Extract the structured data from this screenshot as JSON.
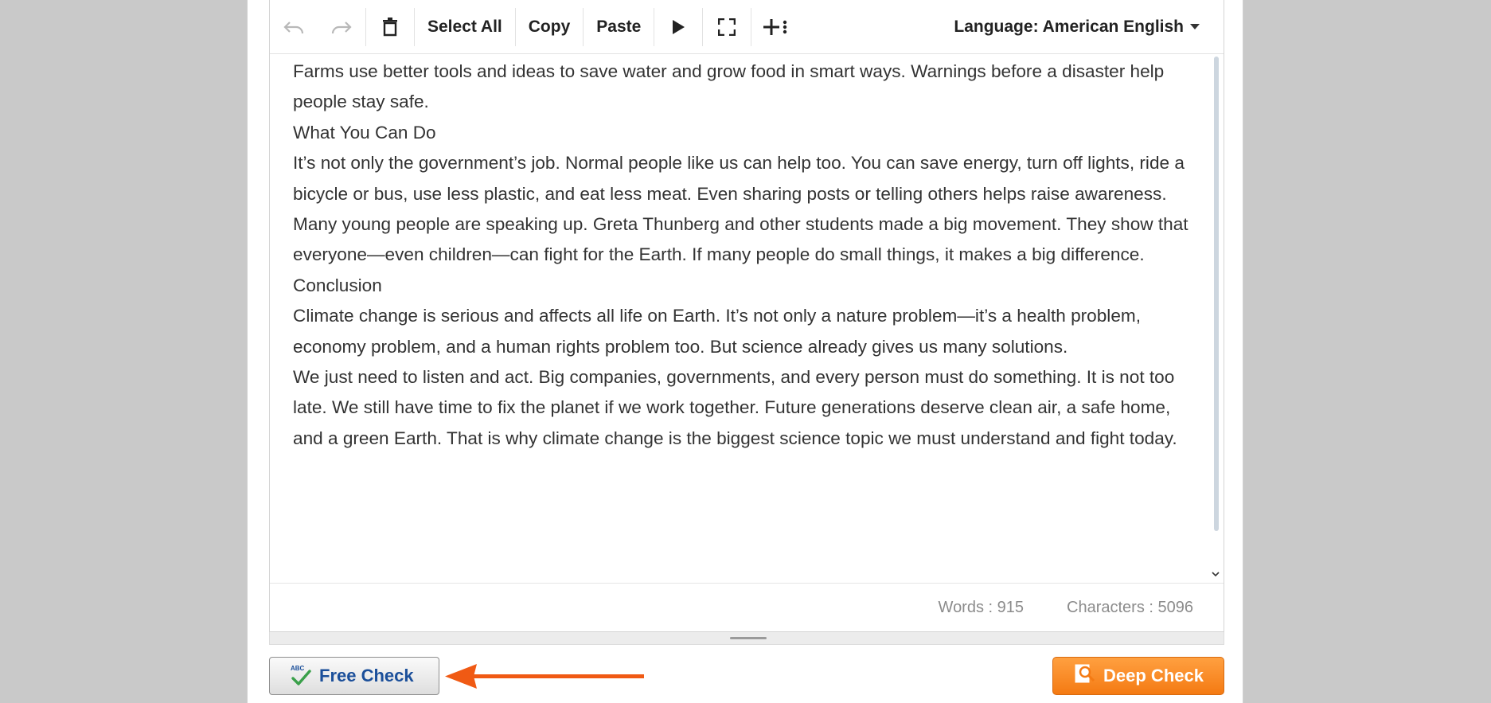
{
  "toolbar": {
    "undo_icon": "undo-icon",
    "redo_icon": "redo-icon",
    "delete_icon": "trash-icon",
    "select_all": "Select All",
    "copy": "Copy",
    "paste": "Paste",
    "play_icon": "play-icon",
    "fullscreen_icon": "fullscreen-icon",
    "add_icon": "add-more-icon",
    "language": "Language: American English"
  },
  "editor": {
    "paragraphs": [
      "Farms use better tools and ideas to save water and grow food in smart ways. Warnings before a disaster help people stay safe.",
      "What You Can Do",
      "It’s not only the government’s job. Normal people like us can help too. You can save energy, turn off lights, ride a bicycle or bus, use less plastic, and eat less meat. Even sharing posts or telling others helps raise awareness.",
      "Many young people are speaking up. Greta Thunberg and other students made a big movement. They show that everyone—even children—can fight for the Earth. If many people do small things, it makes a big difference.",
      "Conclusion",
      "Climate change is serious and affects all life on Earth. It’s not only a nature problem—it’s a health problem, economy problem, and a human rights problem too. But science already gives us many solutions.",
      "We just need to listen and act. Big companies, governments, and every person must do something. It is not too late. We still have time to fix the planet if we work together. Future generations deserve clean air, a safe home, and a green Earth. That is why climate change is the biggest science topic we must understand and fight today."
    ]
  },
  "status": {
    "words": "Words : 915",
    "characters": "Characters : 5096"
  },
  "buttons": {
    "free_check": "Free Check",
    "free_check_icon_text": "ABC",
    "deep_check": "Deep Check"
  },
  "colors": {
    "free_check_text": "#1b4f9a",
    "deep_check_bg": "#f47a13",
    "arrow": "#f05a14"
  }
}
